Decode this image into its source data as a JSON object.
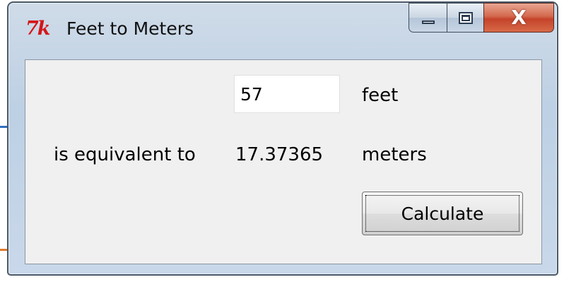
{
  "window": {
    "title": "Feet to Meters",
    "icon": "tk-feather-icon",
    "icon_text": "7k",
    "close_glyph": "X"
  },
  "form": {
    "feet_value": "57",
    "feet_unit": "feet",
    "equiv_label": "is equivalent to",
    "meters_value": "17.37365",
    "meters_unit": "meters",
    "calculate_label": "Calculate"
  },
  "colors": {
    "icon_red": "#d4161a",
    "client_bg": "#f0f0f0",
    "close_button": "#c4432a"
  }
}
